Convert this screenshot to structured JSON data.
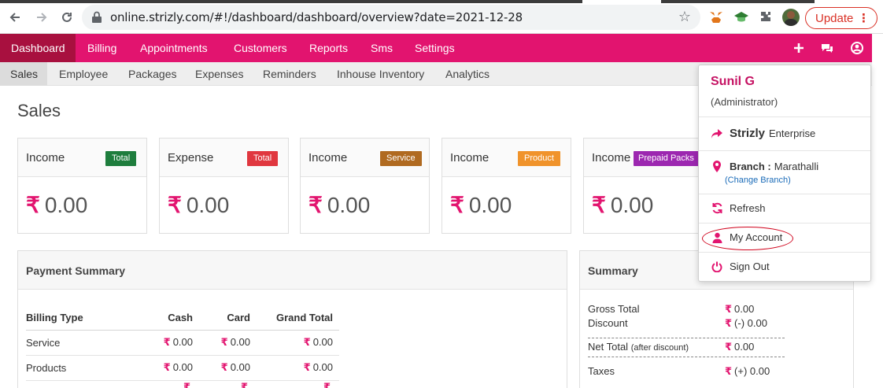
{
  "browser": {
    "url": "online.strizly.com/#!/dashboard/dashboard/overview?date=2021-12-28",
    "update_label": "Update"
  },
  "mainnav": {
    "items": [
      "Dashboard",
      "Billing",
      "Appointments",
      "Customers",
      "Reports",
      "Sms",
      "Settings"
    ],
    "active": "Dashboard"
  },
  "subnav": {
    "items": [
      "Sales",
      "Employee",
      "Packages",
      "Expenses",
      "Reminders",
      "Inhouse Inventory",
      "Analytics"
    ],
    "active": "Sales"
  },
  "page": {
    "title": "Sales"
  },
  "cards": [
    {
      "label": "Income",
      "badge": "Total",
      "badge_color": "#1e7d3d",
      "value": "0.00"
    },
    {
      "label": "Expense",
      "badge": "Total",
      "badge_color": "#e0373f",
      "value": "0.00"
    },
    {
      "label": "Income",
      "badge": "Service",
      "badge_color": "#b06a20",
      "value": "0.00"
    },
    {
      "label": "Income",
      "badge": "Product",
      "badge_color": "#f0932b",
      "value": "0.00"
    },
    {
      "label": "Income",
      "badge": "Prepaid Packs",
      "badge_color": "#9c27b0",
      "value": "0.00"
    }
  ],
  "currency_symbol": "₹",
  "payment_summary": {
    "title": "Payment Summary",
    "columns": [
      "Billing Type",
      "Cash",
      "Card",
      "Grand Total"
    ],
    "rows": [
      {
        "type": "Service",
        "cash": "0.00",
        "card": "0.00",
        "total": "0.00"
      },
      {
        "type": "Products",
        "cash": "0.00",
        "card": "0.00",
        "total": "0.00"
      }
    ]
  },
  "summary": {
    "title": "Summary",
    "gross_total_label": "Gross Total",
    "gross_total_value": "0.00",
    "discount_label": "Discount",
    "discount_value": "(-) 0.00",
    "net_total_label": "Net Total",
    "net_total_note": "(after discount)",
    "net_total_value": "0.00",
    "taxes_label": "Taxes",
    "taxes_value": "(+) 0.00"
  },
  "user_menu": {
    "name": "Sunil G",
    "role": "(Administrator)",
    "brand": "Strizly",
    "edition": "Enterprise",
    "branch_label": "Branch :",
    "branch_value": "Marathalli",
    "change_branch": "(Change Branch)",
    "refresh": "Refresh",
    "my_account": "My Account",
    "sign_out": "Sign Out"
  },
  "colors": {
    "brand": "#e2146f",
    "brand_dark": "#a8103f"
  }
}
